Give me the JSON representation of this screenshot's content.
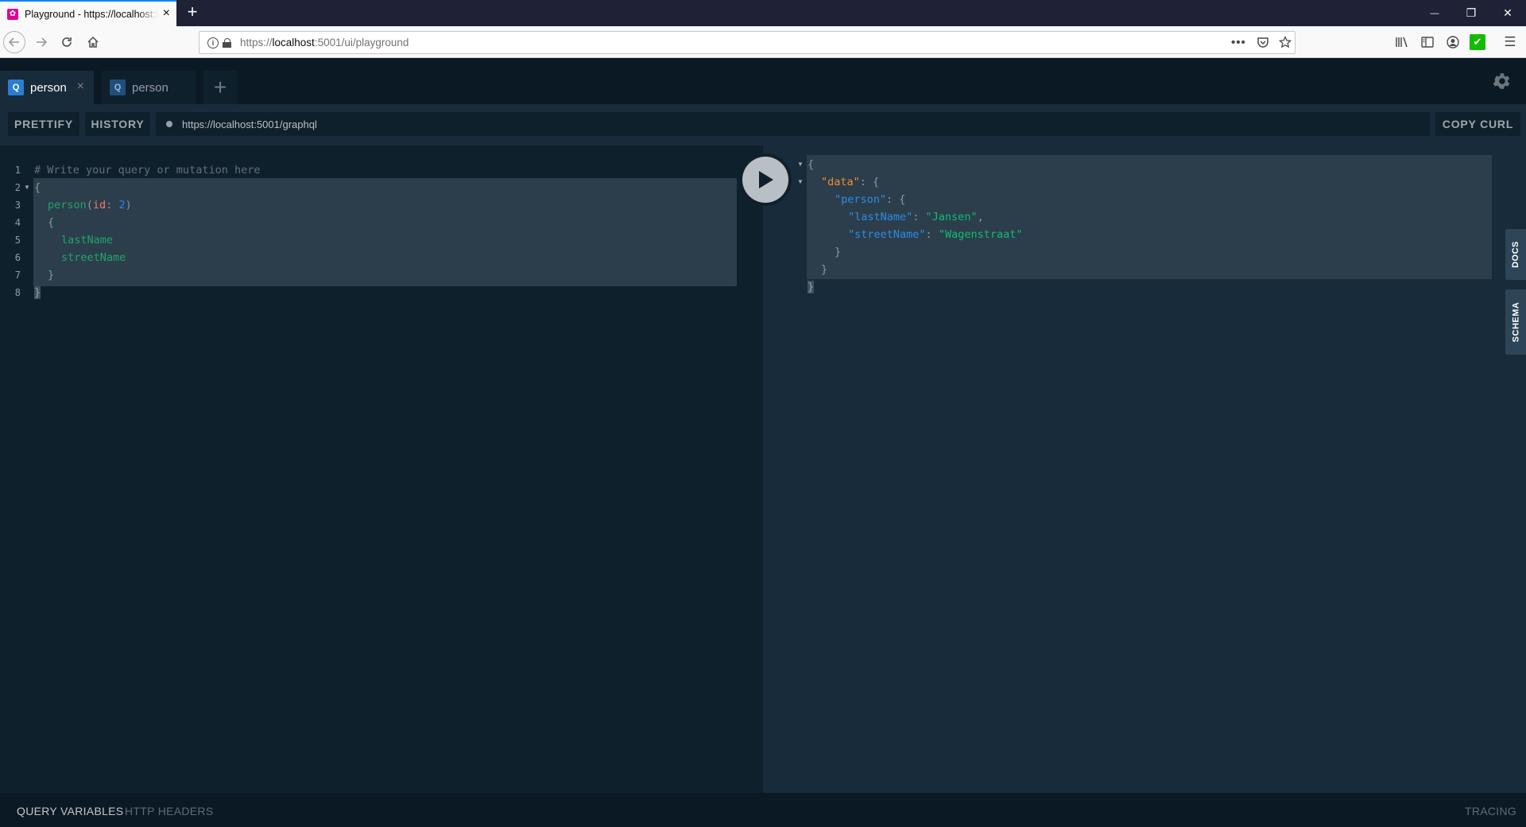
{
  "browser": {
    "tab_title": "Playground - https://localhost:5001/ui/playground",
    "tab_close": "×",
    "new_tab": "+",
    "url_prefix": "https://",
    "url_host": "localhost",
    "url_rest": ":5001/ui/playground",
    "url_more": "•••",
    "window_min": "—",
    "window_max": "❐",
    "window_close": "✕"
  },
  "playground": {
    "tabs": [
      {
        "badge": "Q",
        "label": "person",
        "close": "×"
      },
      {
        "badge": "Q",
        "label": "person"
      }
    ],
    "add_tab": "+",
    "toolbar": {
      "prettify": "PRETTIFY",
      "history": "HISTORY",
      "endpoint": "https://localhost:5001/graphql",
      "copy_curl": "COPY CURL"
    },
    "editor": {
      "line_numbers": [
        "1",
        "2",
        "3",
        "4",
        "5",
        "6",
        "7",
        "8"
      ],
      "comment": "# Write your query or mutation here",
      "open_brace": "{",
      "query_field": "person",
      "arg_name": "id",
      "arg_value": "2",
      "field_1": "lastName",
      "field_2": "streetName",
      "close_brace": "}"
    },
    "result": {
      "key_data": "\"data\"",
      "key_person": "\"person\"",
      "key_lastName": "\"lastName\"",
      "val_lastName": "\"Jansen\"",
      "key_streetName": "\"streetName\"",
      "val_streetName": "\"Wagenstraat\""
    },
    "side_tabs": {
      "docs": "DOCS",
      "schema": "SCHEMA"
    },
    "bottom": {
      "query_variables": "QUERY VARIABLES",
      "http_headers": "HTTP HEADERS",
      "tracing": "TRACING"
    }
  }
}
